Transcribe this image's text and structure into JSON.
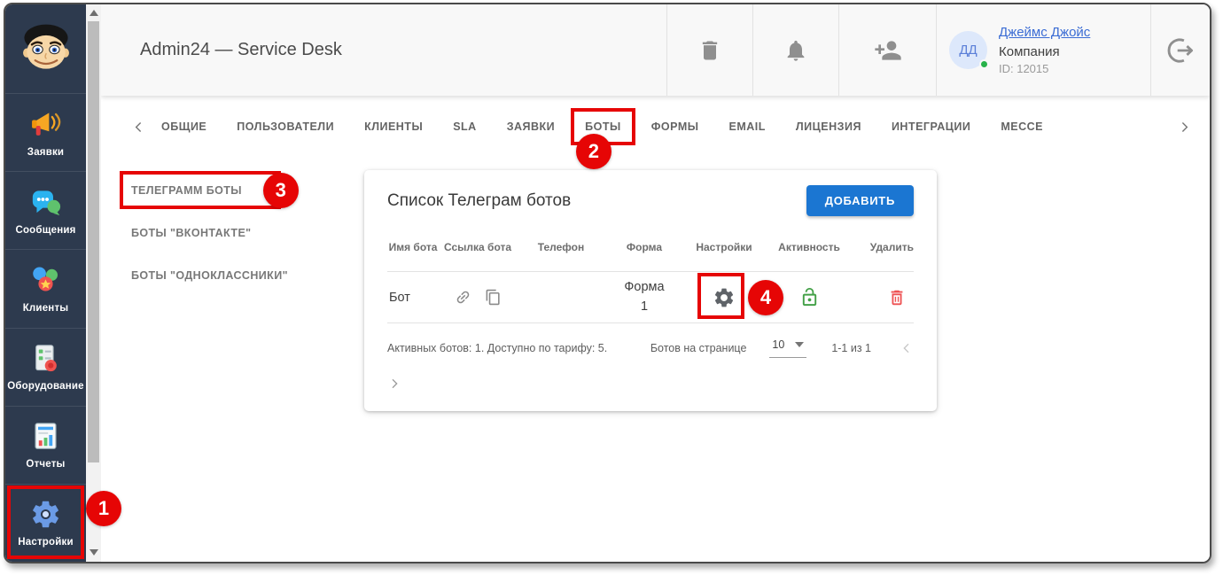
{
  "header": {
    "title": "Admin24 — Service Desk",
    "user": {
      "initials": "ДД",
      "name": "Джеймс Джойс",
      "company": "Компания",
      "id_label": "ID: 12015"
    }
  },
  "sidebar": {
    "items": [
      {
        "label": "Заявки",
        "icon": "megaphone-icon"
      },
      {
        "label": "Сообщения",
        "icon": "chat-icon"
      },
      {
        "label": "Клиенты",
        "icon": "clients-icon"
      },
      {
        "label": "Оборудование",
        "icon": "equipment-icon"
      },
      {
        "label": "Отчеты",
        "icon": "reports-icon"
      },
      {
        "label": "Настройки",
        "icon": "gear-icon"
      }
    ]
  },
  "tabs": {
    "items": [
      "ОБЩИЕ",
      "ПОЛЬЗОВАТЕЛИ",
      "КЛИЕНТЫ",
      "SLA",
      "ЗАЯВКИ",
      "БОТЫ",
      "ФОРМЫ",
      "EMAIL",
      "ЛИЦЕНЗИЯ",
      "ИНТЕГРАЦИИ",
      "МЕССЕ"
    ],
    "active": "БОТЫ"
  },
  "submenu": {
    "items": [
      "ТЕЛЕГРАММ БОТЫ",
      "БОТЫ \"ВКОНТАКТЕ\"",
      "БОТЫ \"ОДНОКЛАССНИКИ\""
    ],
    "active": "ТЕЛЕГРАММ БОТЫ"
  },
  "card": {
    "title": "Список Телеграм ботов",
    "add_button": "ДОБАВИТЬ",
    "table": {
      "columns": [
        "Имя бота",
        "Ссылка бота",
        "Телефон",
        "Форма",
        "Настройки",
        "Активность",
        "Удалить"
      ],
      "rows": [
        {
          "name": "Бот",
          "phone": "",
          "form": "Форма 1"
        }
      ]
    },
    "footer": {
      "summary": "Активных ботов: 1. Доступно по тарифу: 5.",
      "per_page_label": "Ботов на странице",
      "per_page_value": "10",
      "range_label": "1-1 из 1"
    }
  },
  "annotations": {
    "steps": [
      "1",
      "2",
      "3",
      "4"
    ]
  },
  "colors": {
    "annotation_red": "#e60505",
    "primary_blue": "#1b76d2",
    "sidebar_bg": "#2d3a4e",
    "link_blue": "#3b6cd4",
    "active_green": "#43a047",
    "danger_red": "#ee5253",
    "online_green": "#27b24a"
  }
}
